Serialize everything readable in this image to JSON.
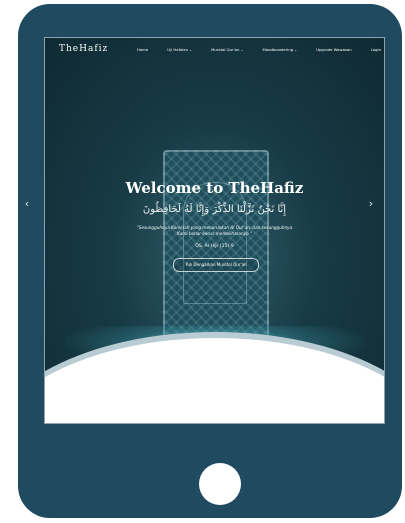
{
  "site": {
    "logo": "TheHafiz"
  },
  "nav": {
    "items": [
      {
        "label": "Home",
        "caret": ""
      },
      {
        "label": "Uji Hafalan",
        "caret": "⌄"
      },
      {
        "label": "Murotal Qur'an",
        "caret": "⌄"
      },
      {
        "label": "Moodbooster​ing",
        "caret": "⌄"
      },
      {
        "label": "Upgrade Wawasan",
        "caret": ""
      },
      {
        "label": "Login",
        "caret": ""
      }
    ]
  },
  "hero": {
    "title": "Welcome to TheHafiz",
    "arabic": "إِنَّا نَحْنُ نَزَّلْنَا الذِّكْرَ وَإِنَّا لَهُ لَحَافِظُونَ",
    "translation": "\"Sesungguhnya Kami-lah yang menurunkan Al Qur'an, dan sesungguhnya Kami benar-benar memeliharanya.\"",
    "reference": "QS. Al Hijr (15):9",
    "cta_label": "Yuk Dengarkan Murotal Qur'an",
    "prev_arrow": "‹",
    "next_arrow": "›"
  },
  "colors": {
    "tablet": "#1f4a60",
    "hero_dark": "#0f2a33",
    "glow": "#8cebf0"
  }
}
